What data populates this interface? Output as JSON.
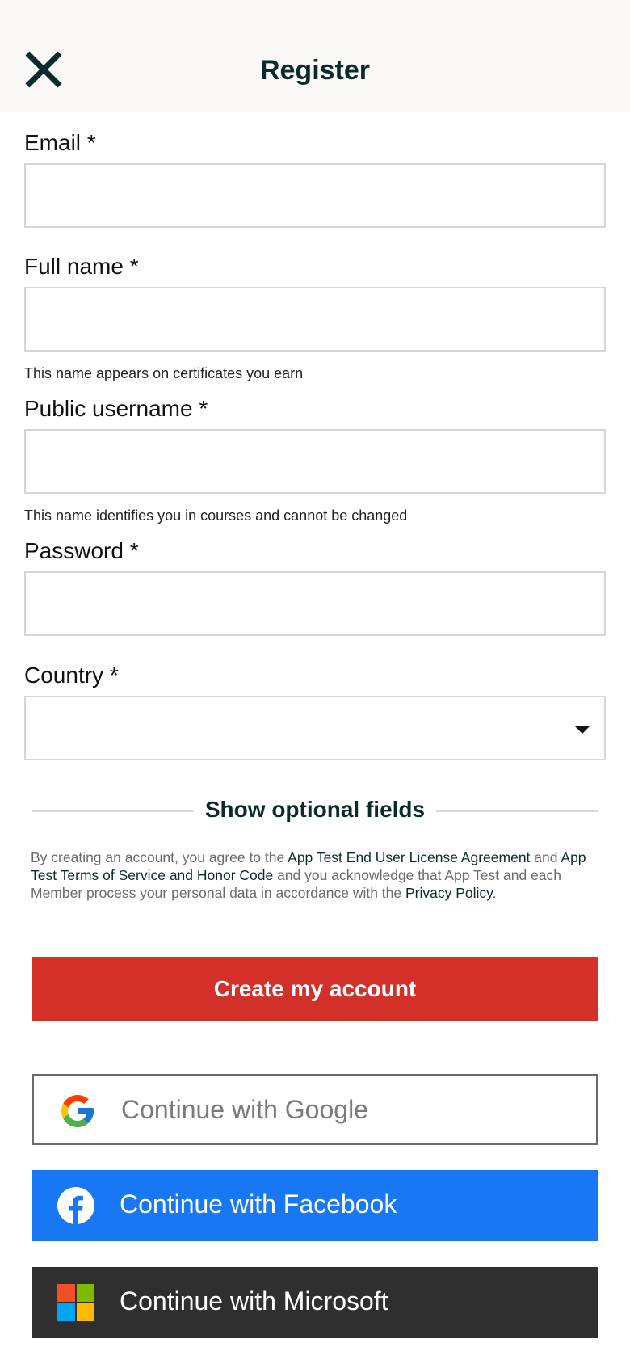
{
  "header": {
    "title": "Register",
    "close_icon": "close-icon"
  },
  "form": {
    "email": {
      "label": "Email *",
      "value": "",
      "placeholder": ""
    },
    "full_name": {
      "label": "Full name *",
      "value": "",
      "placeholder": "",
      "help": "This name appears on certificates you earn"
    },
    "username": {
      "label": "Public username *",
      "value": "",
      "placeholder": "",
      "help": "This name identifies you in courses and cannot be changed"
    },
    "password": {
      "label": "Password *",
      "value": "",
      "placeholder": ""
    },
    "country": {
      "label": "Country *",
      "value": ""
    }
  },
  "optional_fields": {
    "label": "Show optional fields"
  },
  "legal": {
    "part1": "By creating an account, you agree to the ",
    "link1": "App Test End User License Agreement",
    "part2": " and ",
    "link2": "App Test Terms of Service and Honor Code",
    "part3": " and you acknowledge that App Test and each Member process your personal data in accordance with the ",
    "link3": "Privacy Policy",
    "part4": "."
  },
  "actions": {
    "create_label": "Create my account"
  },
  "social": {
    "google_label": "Continue with Google",
    "facebook_label": "Continue with Facebook",
    "microsoft_label": "Continue with Microsoft"
  },
  "colors": {
    "accent_red": "#d3302a",
    "facebook_blue": "#1877f2",
    "microsoft_dark": "#2f2f2f",
    "title_dark": "#0b2b2b"
  }
}
